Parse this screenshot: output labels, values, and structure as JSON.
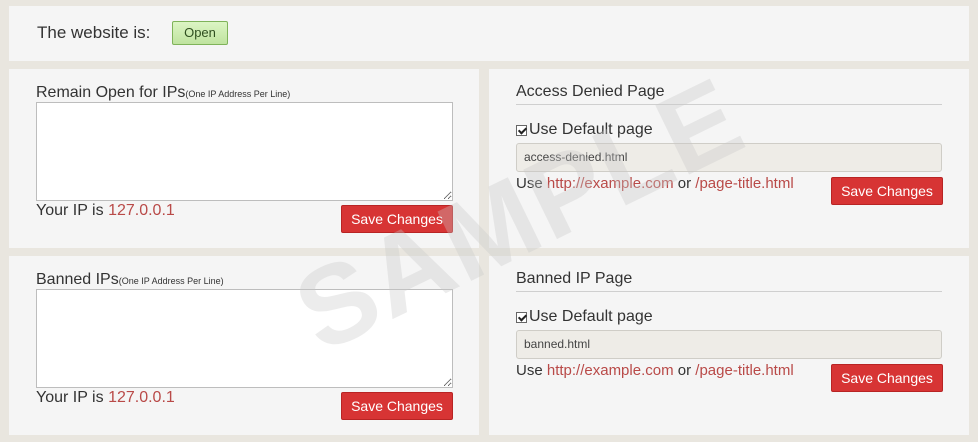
{
  "status": {
    "label": "The website is:",
    "button_label": "Open"
  },
  "remain_open": {
    "title": "Remain Open for IPs",
    "subtitle": "(One IP Address Per Line)",
    "textarea_value": "",
    "your_ip_label": "Your IP is",
    "your_ip_value": "127.0.0.1",
    "save_label": "Save Changes"
  },
  "banned_ips": {
    "title": "Banned IPs",
    "subtitle": "(One IP Address Per Line)",
    "textarea_value": "",
    "your_ip_label": "Your IP is",
    "your_ip_value": "127.0.0.1",
    "save_label": "Save Changes"
  },
  "access_denied": {
    "heading": "Access Denied Page",
    "checkbox_label": "Use Default page",
    "checkbox_checked": true,
    "input_value": "access-denied.html",
    "use_text": "Use",
    "link1": "http://example.com",
    "or_text": "or",
    "link2": "/page-title.html",
    "save_label": "Save Changes"
  },
  "banned_page": {
    "heading": "Banned IP Page",
    "checkbox_label": "Use Default page",
    "checkbox_checked": true,
    "input_value": "banned.html",
    "use_text": "Use",
    "link1": "http://example.com",
    "or_text": "or",
    "link2": "/page-title.html",
    "save_label": "Save Changes"
  },
  "watermark": "SAMPLE",
  "colors": {
    "background": "#e9e6df",
    "panel": "#f5f5f5",
    "accent_red": "#d73434",
    "link_red": "#b94a48",
    "open_green": "#c8eaa8"
  }
}
